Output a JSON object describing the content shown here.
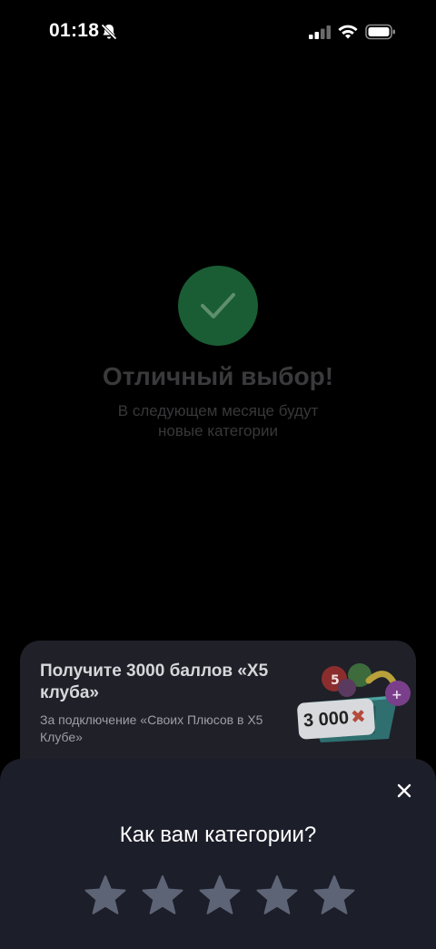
{
  "status_bar": {
    "time": "01:18"
  },
  "background": {
    "title": "Отличный выбор!",
    "subtitle": "В следующем месяце будут новые категории",
    "colors": {
      "success_circle": "#1a5d34",
      "dim_text": "#3a3a3c"
    }
  },
  "promo": {
    "title": "Получите 3000 баллов «X5 клуба»",
    "text": "За подключение «Своих Плюсов в X5 Клубе»",
    "badge_value": "3 000",
    "badge_symbol": "✖"
  },
  "rating_sheet": {
    "title": "Как вам категории?",
    "close_icon": "close-icon",
    "star_count": 5,
    "selected_rating": 0,
    "star_color": "#5d6476"
  }
}
